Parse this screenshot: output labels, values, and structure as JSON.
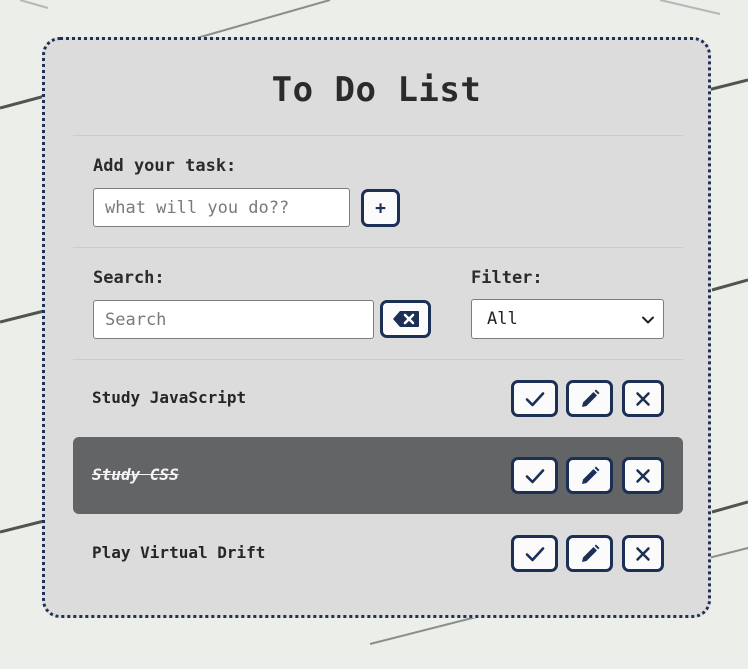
{
  "app": {
    "title": "To Do List"
  },
  "add_task": {
    "label": "Add your task:",
    "input_value": "",
    "input_placeholder": "what will you do??",
    "add_button_label": "+"
  },
  "search": {
    "label": "Search:",
    "input_value": "",
    "input_placeholder": "Search",
    "clear_icon": "backspace-icon"
  },
  "filter": {
    "label": "Filter:",
    "selected": "All",
    "chevron_icon": "chevron-down-icon"
  },
  "tasks": [
    {
      "text": "Study JavaScript",
      "completed": false
    },
    {
      "text": "Study CSS",
      "completed": true
    },
    {
      "text": "Play Virtual Drift",
      "completed": false
    }
  ],
  "task_actions": {
    "complete_icon": "check-icon",
    "edit_icon": "pencil-icon",
    "delete_icon": "close-icon"
  },
  "colors": {
    "page_background": "#eceeea",
    "card_background": "#dcdcdc",
    "accent": "#1c2f55",
    "completed_row": "#636466"
  }
}
